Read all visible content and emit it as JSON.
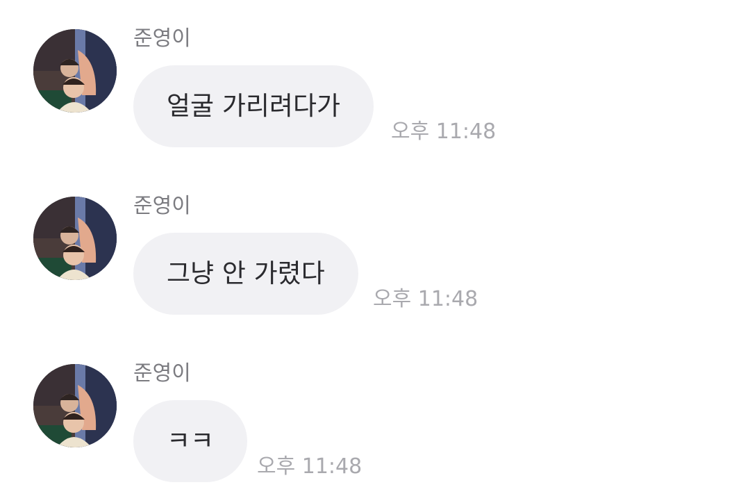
{
  "chat": {
    "messages": [
      {
        "sender": "준영이",
        "text": "얼굴 가리려다가",
        "time": "오후 11:48",
        "avatar_icon": "profile-photo"
      },
      {
        "sender": "준영이",
        "text": "그냥 안 가렸다",
        "time": "오후 11:48",
        "avatar_icon": "profile-photo"
      },
      {
        "sender": "준영이",
        "text": "ㅋㅋ",
        "time": "오후 11:48",
        "avatar_icon": "profile-photo"
      }
    ]
  },
  "colors": {
    "bubble": "#f1f1f4",
    "message_text": "#2a2a2e",
    "sender_text": "#7b7b80",
    "time_text": "#a9a9ae"
  }
}
